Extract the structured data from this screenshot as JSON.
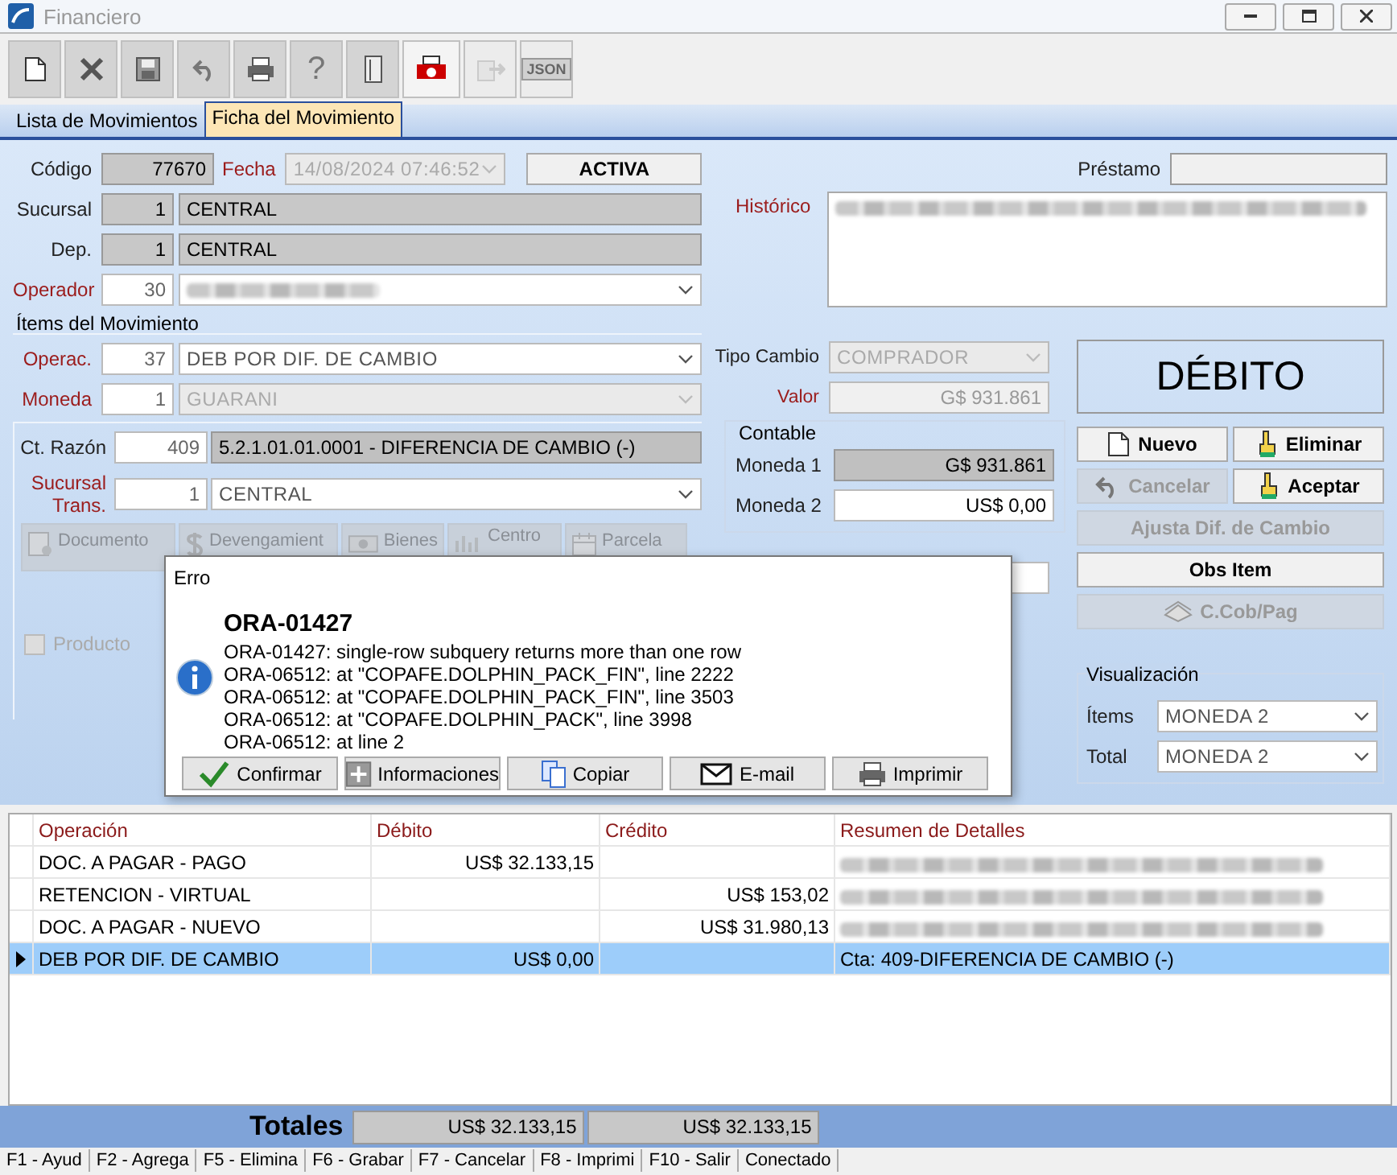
{
  "window": {
    "title": "Financiero"
  },
  "toolbar": [
    {
      "disabled": false
    },
    {
      "disabled": false
    },
    {
      "disabled": false
    },
    {
      "disabled": false
    },
    {
      "disabled": false
    },
    {
      "label": "?",
      "disabled": false
    },
    {
      "disabled": false
    },
    {
      "disabled": false
    },
    {
      "disabled": true
    },
    {
      "label": "JSON",
      "disabled": true
    }
  ],
  "tabs": [
    {
      "label": "Lista de Movimientos",
      "selected": false
    },
    {
      "label": "Ficha del Movimiento",
      "selected": true
    }
  ],
  "header": {
    "codigo": {
      "label": "Código",
      "required": false,
      "value": "77670"
    },
    "fecha": {
      "label": "Fecha",
      "required": true,
      "value": "14/08/2024 07:46:52",
      "disabled": true
    },
    "status": "ACTIVA",
    "sucursal": {
      "label": "Sucursal",
      "required": false,
      "code": "1",
      "value": "CENTRAL"
    },
    "dep": {
      "label": "Dep.",
      "required": false,
      "code": "1",
      "value": "CENTRAL"
    },
    "operador": {
      "label": "Operador",
      "required": true,
      "code": "30"
    },
    "prestamo": {
      "label": "Préstamo",
      "required": false
    },
    "historico": {
      "label": "Histórico",
      "required": true
    }
  },
  "items": {
    "title": "Ítems del Movimiento",
    "operac": {
      "label": "Operac.",
      "required": true,
      "code": "37",
      "value": "DEB POR DIF. DE CAMBIO",
      "disabled": false
    },
    "moneda": {
      "label": "Moneda",
      "required": true,
      "code": "1",
      "value": "GUARANI",
      "disabled": true
    },
    "ct_razon": {
      "label": "Ct. Razón",
      "required": false,
      "code": "409",
      "value": "5.2.1.01.01.0001 - DIFERENCIA DE CAMBIO (-)"
    },
    "sucursal_trans": {
      "label": "Sucursal Trans.",
      "required": true,
      "code": "1",
      "value": "CENTRAL",
      "disabled": false
    },
    "buttons": [
      {
        "label": "Documento",
        "disabled": true
      },
      {
        "label": "Devengamient",
        "disabled": true
      },
      {
        "label": "Bienes",
        "disabled": true
      },
      {
        "label": "Centro",
        "disabled": true
      },
      {
        "label": "Parcela",
        "disabled": true
      }
    ],
    "producto": {
      "label": "Producto",
      "checked": false,
      "disabled": true
    },
    "tipo_cambio": {
      "label": "Tipo Cambio",
      "required": false,
      "value": "COMPRADOR",
      "disabled": true
    },
    "valor": {
      "label": "Valor",
      "required": true,
      "value": "G$ 931.861",
      "disabled": true
    },
    "contable": {
      "title": "Contable",
      "rows": [
        {
          "label": "Moneda 1",
          "value": "G$ 931.861",
          "kind": "readonly"
        },
        {
          "label": "Moneda 2",
          "value": "US$ 0,00",
          "kind": "editable"
        }
      ]
    },
    "type": "DÉBITO",
    "actions": [
      {
        "label": "Nuevo",
        "kind": "half",
        "disabled": false
      },
      {
        "label": "Eliminar",
        "kind": "half",
        "disabled": false
      },
      {
        "label": "Cancelar",
        "kind": "half",
        "disabled": true
      },
      {
        "label": "Aceptar",
        "kind": "half",
        "disabled": false
      },
      {
        "label": "Ajusta Dif. de Cambio",
        "kind": "full",
        "disabled": true
      },
      {
        "label": "Obs Item",
        "kind": "full",
        "disabled": false
      },
      {
        "label": "C.Cob/Pag",
        "kind": "full",
        "disabled": true
      }
    ],
    "visualizacion": {
      "title": "Visualización",
      "rows": [
        {
          "label": "Ítems",
          "value": "MONEDA 2"
        },
        {
          "label": "Total",
          "value": "MONEDA 2"
        }
      ]
    }
  },
  "table": {
    "columns": [
      "Operación",
      "Débito",
      "Crédito",
      "Resumen de Detalles"
    ],
    "rows": [
      {
        "operacion": "DOC. A PAGAR - PAGO",
        "debito": "US$ 32.133,15",
        "selected": false
      },
      {
        "operacion": "RETENCION - VIRTUAL",
        "credito": "US$ 153,02",
        "selected": false
      },
      {
        "operacion": "DOC. A PAGAR - NUEVO",
        "credito": "US$ 31.980,13",
        "selected": false
      },
      {
        "operacion": "DEB POR DIF. DE CAMBIO",
        "debito": "US$ 0,00",
        "resumen": "Cta: 409-DIFERENCIA DE CAMBIO (-)",
        "selected": true
      }
    ]
  },
  "totals": {
    "label": "Totales",
    "debito": "US$ 32.133,15",
    "credito": "US$ 32.133,15"
  },
  "dialog": {
    "title": "Erro",
    "heading": "ORA-01427",
    "lines": [
      "ORA-01427: single-row subquery returns more than one row",
      "ORA-06512: at \"COPAFE.DOLPHIN_PACK_FIN\", line 2222",
      "ORA-06512: at \"COPAFE.DOLPHIN_PACK_FIN\", line 3503",
      "ORA-06512: at \"COPAFE.DOLPHIN_PACK\", line 3998",
      "ORA-06512: at line 2"
    ],
    "buttons": [
      {
        "label": "Confirmar"
      },
      {
        "label": "Informaciones"
      },
      {
        "label": "Copiar"
      },
      {
        "label": "E-mail"
      },
      {
        "label": "Imprimir"
      }
    ]
  },
  "status_bar": [
    "F1 - Ayud",
    "F2 - Agrega",
    "F5 - Elimina",
    "F6 - Grabar",
    "F7 - Cancelar",
    "F8 - Imprimi",
    "F10 - Salir",
    "Conectado"
  ]
}
